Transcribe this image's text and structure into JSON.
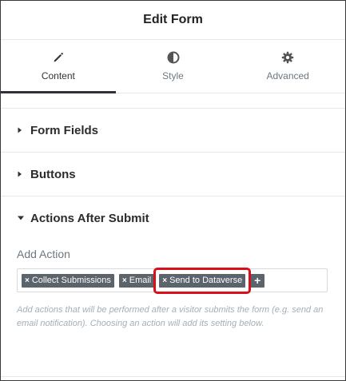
{
  "header": {
    "title": "Edit Form"
  },
  "tabs": [
    {
      "label": "Content",
      "icon": "pencil-icon",
      "active": true
    },
    {
      "label": "Style",
      "icon": "half-circle-icon",
      "active": false
    },
    {
      "label": "Advanced",
      "icon": "gear-icon",
      "active": false
    }
  ],
  "sections": [
    {
      "title": "Form Fields",
      "expanded": false
    },
    {
      "title": "Buttons",
      "expanded": false
    },
    {
      "title": "Actions After Submit",
      "expanded": true
    }
  ],
  "actions": {
    "label": "Add Action",
    "remove_glyph": "×",
    "tags": [
      "Collect Submissions",
      "Email",
      "Send to Dataverse"
    ],
    "add_glyph": "+",
    "help": "Add actions that will be performed after a visitor submits the form (e.g. send an email notification). Choosing an action will add its setting below."
  },
  "colors": {
    "highlight": "#d9101a",
    "tag_bg": "#5b636b"
  }
}
